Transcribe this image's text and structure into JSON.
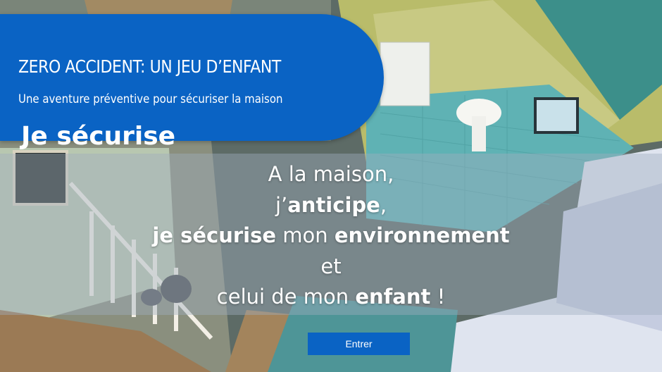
{
  "header": {
    "title": "ZERO ACCIDENT: UN JEU D’ENFANT",
    "subtitle": "Une aventure préventive pour sécuriser la maison",
    "section": "Je sécurise"
  },
  "message": {
    "line1": "A la maison,",
    "line2_pre": "j’",
    "line2_bold": "anticipe",
    "line2_post": ",",
    "line3_a": "je ",
    "line3_b": "sécurise",
    "line3_c": " mon ",
    "line3_d": "environnement",
    "line4": "et",
    "line5_a": "celui de mon ",
    "line5_b": "enfant",
    "line5_c": " !"
  },
  "enter_button": {
    "label": "Entrer"
  },
  "colors": {
    "brand_blue": "#0a63c4",
    "text_white": "#ffffff",
    "band_overlay": "rgba(160,174,190,0.42)"
  }
}
